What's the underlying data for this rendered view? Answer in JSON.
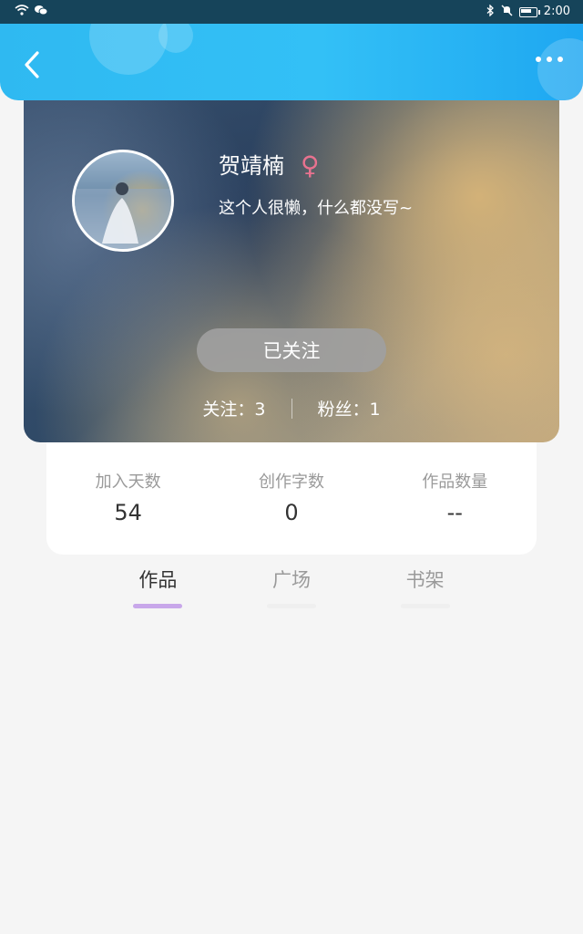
{
  "status_bar": {
    "time": "2:00",
    "icons": [
      "wifi-icon",
      "wechat-icon",
      "bluetooth-icon",
      "mute-icon",
      "battery-icon"
    ]
  },
  "header": {
    "back_icon": "chevron-left-icon",
    "more_icon": "more-dots-icon"
  },
  "profile": {
    "name": "贺靖楠",
    "gender_symbol": "♀",
    "bio": "这个人很懒，什么都没写~",
    "follow_button": "已关注",
    "following_label": "关注：3",
    "followers_label": "粉丝：1"
  },
  "info": [
    {
      "label": "加入天数",
      "value": "54"
    },
    {
      "label": "创作字数",
      "value": "0"
    },
    {
      "label": "作品数量",
      "value": "--"
    }
  ],
  "tabs": [
    {
      "label": "作品",
      "active": true
    },
    {
      "label": "广场",
      "active": false
    },
    {
      "label": "书架",
      "active": false
    }
  ],
  "colors": {
    "header_accent": "#2fb9f1",
    "tab_indicator": "#c8a7ea",
    "gender_color": "#e8728f"
  }
}
